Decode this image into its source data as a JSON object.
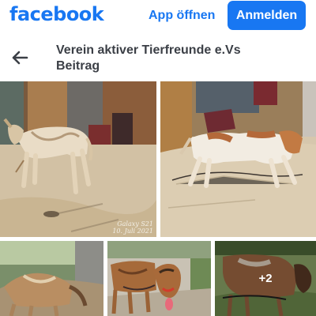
{
  "topbar": {
    "logo_text": "facebook",
    "app_open_label": "App öffnen",
    "login_label": "Anmelden"
  },
  "header": {
    "back_icon": "arrow-left-icon",
    "title_line1": "Verein aktiver Tierfreunde e.Vs",
    "title_line2": "Beitrag"
  },
  "gallery": {
    "photo1_watermark_line1": "Galaxy S21",
    "photo1_watermark_line2": "10. Juli 2021",
    "more_count": "+2"
  },
  "colors": {
    "brand": "#1877f2",
    "title_text": "#3b3f46"
  }
}
